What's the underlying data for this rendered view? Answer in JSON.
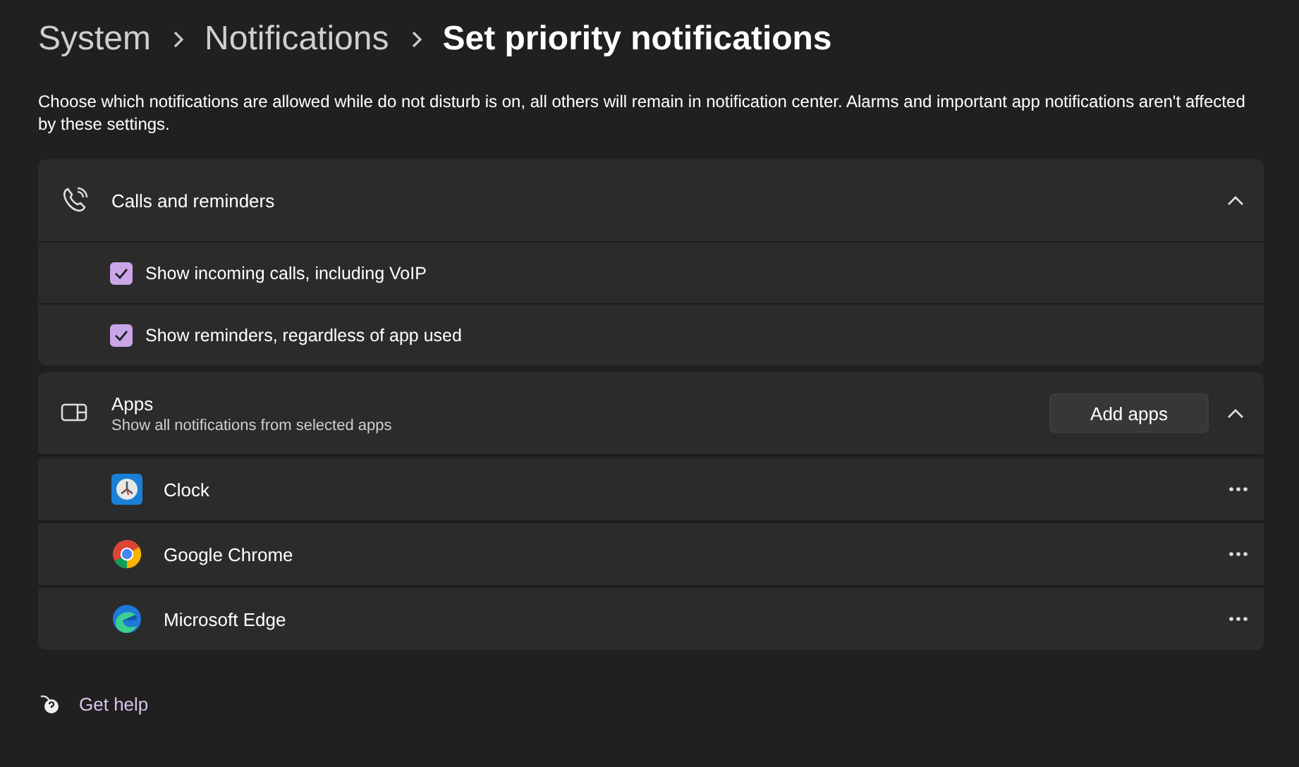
{
  "breadcrumb": [
    {
      "label": "System",
      "current": false
    },
    {
      "label": "Notifications",
      "current": false
    },
    {
      "label": "Set priority notifications",
      "current": true
    }
  ],
  "description": "Choose which notifications are allowed while do not disturb is on, all others will remain in notification center. Alarms and important app notifications aren't affected by these settings.",
  "calls_section": {
    "title": "Calls and reminders",
    "expanded": true,
    "options": [
      {
        "label": "Show incoming calls, including VoIP",
        "checked": true
      },
      {
        "label": "Show reminders, regardless of app used",
        "checked": true
      }
    ]
  },
  "apps_section": {
    "title": "Apps",
    "subtitle": "Show all notifications from selected apps",
    "button": "Add apps",
    "expanded": true,
    "apps": [
      {
        "name": "Clock"
      },
      {
        "name": "Google Chrome"
      },
      {
        "name": "Microsoft Edge"
      }
    ]
  },
  "help_link": "Get help"
}
